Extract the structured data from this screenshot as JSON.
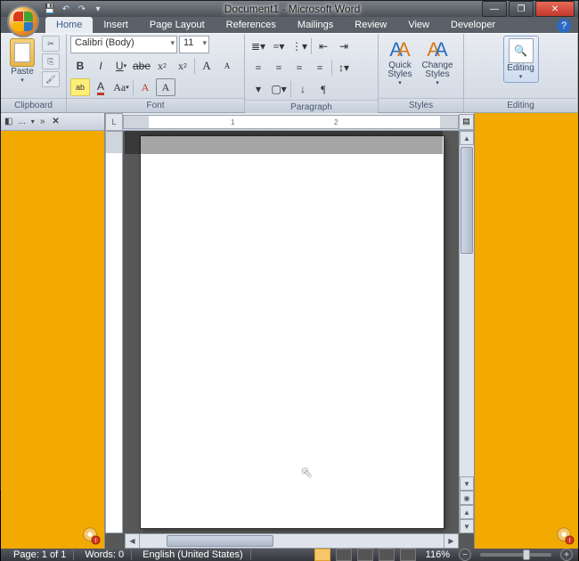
{
  "title": "Document1 - Microsoft Word",
  "tabs": [
    "Home",
    "Insert",
    "Page Layout",
    "References",
    "Mailings",
    "Review",
    "View",
    "Developer"
  ],
  "active_tab": 0,
  "ribbon": {
    "clipboard": {
      "label": "Clipboard",
      "paste": "Paste"
    },
    "font": {
      "label": "Font",
      "name": "Calibri (Body)",
      "size": "11",
      "row2": [
        "B",
        "I",
        "U",
        "abe",
        "x₂",
        "x²"
      ],
      "row3": [
        "ab",
        "A",
        "Aa",
        "A",
        "A"
      ]
    },
    "paragraph": {
      "label": "Paragraph"
    },
    "styles": {
      "label": "Styles",
      "quick": "Quick Styles",
      "change": "Change Styles"
    },
    "editing": {
      "label": "Editing",
      "btn": "Editing"
    }
  },
  "side_toolbar": {
    "dots": "...",
    "chev": "»"
  },
  "ruler": {
    "marks": [
      "1",
      "2"
    ]
  },
  "status": {
    "page": "Page: 1 of 1",
    "words": "Words: 0",
    "lang": "English (United States)",
    "zoom": "116%"
  }
}
